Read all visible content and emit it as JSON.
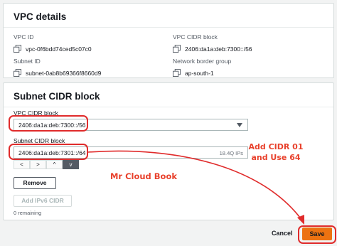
{
  "vpc_details": {
    "title": "VPC details",
    "vpc_id_label": "VPC ID",
    "vpc_id_value": "vpc-0f6bdd74ced5c07c0",
    "vpc_cidr_label": "VPC CIDR block",
    "vpc_cidr_value": "2406:da1a:deb:7300::/56",
    "subnet_id_label": "Subnet ID",
    "subnet_id_value": "subnet-0ab8b69366f8660d9",
    "border_group_label": "Network border group",
    "border_group_value": "ap-south-1"
  },
  "subnet_cidr": {
    "title": "Subnet CIDR block",
    "vpc_cidr_label": "VPC CIDR block",
    "vpc_cidr_selected": "2406:da1a:deb:7300::/56",
    "subnet_cidr_label": "Subnet CIDR block",
    "subnet_cidr_value": "2406:da1a:deb:7301::/64",
    "ips_suffix": "18.4Q IPs",
    "arrows": [
      "<",
      ">",
      "^",
      "v"
    ],
    "remove_label": "Remove",
    "add_ipv6_label": "Add IPv6 CIDR",
    "remaining": "0 remaining"
  },
  "annotations": {
    "instruction_line1": "Add  CIDR  01",
    "instruction_line2": "and Use 64",
    "watermark": "Mr Cloud Book",
    "color": "#e8412c"
  },
  "footer": {
    "cancel_label": "Cancel",
    "save_label": "Save"
  },
  "colors": {
    "accent": "#ec7211",
    "highlight": "#e02b2b"
  }
}
